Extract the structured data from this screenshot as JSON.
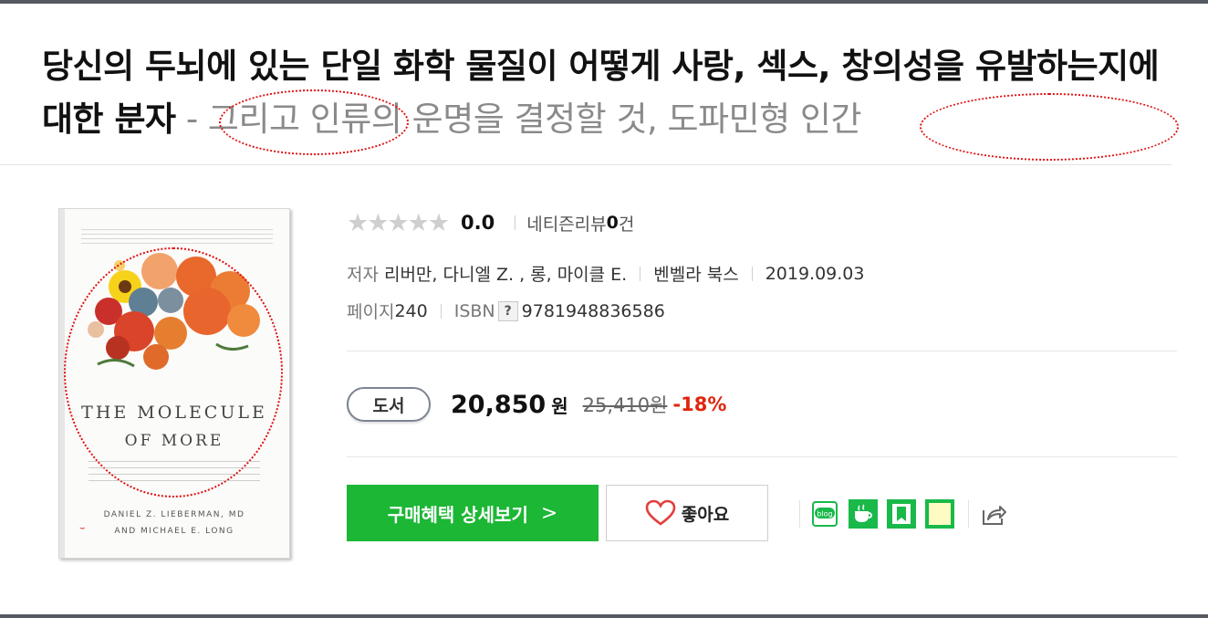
{
  "title": {
    "main": "당신의 두뇌에 있는 단일 화학 물질이 어떻게 사랑, 섹스, 창의성을 유발하는지에 대한 분자",
    "sub": "- 그리고 인류의 운명을 결정할 것, 도파민형 인간"
  },
  "cover": {
    "title_line1": "THE MOLECULE",
    "title_line2": "OF MORE",
    "author1": "DANIEL Z. LIEBERMAN, MD",
    "author2": "AND MICHAEL E. LONG"
  },
  "rating": {
    "stars": "★★★★★",
    "value": "0.0",
    "review_label": "네티즌리뷰",
    "review_count": "0",
    "review_unit": "건"
  },
  "meta": {
    "author_label": "저자",
    "authors": "리버만, 다니엘 Z. , 롱, 마이클 E.",
    "publisher": "벤벨라 북스",
    "date": "2019.09.03",
    "page_label": "페이지",
    "pages": "240",
    "isbn_label": "ISBN",
    "isbn_help": "?",
    "isbn": "9781948836586"
  },
  "price": {
    "badge": "도서",
    "sale_price": "20,850",
    "unit": "원",
    "original": "25,410원",
    "discount": "-18%"
  },
  "actions": {
    "buy_label": "구매혜택 상세보기",
    "buy_chevron": ">",
    "like_label": "좋아요"
  },
  "share": {
    "icons": [
      "blog-icon",
      "cafe-icon",
      "bookmark-icon",
      "memo-icon",
      "share-icon"
    ],
    "blog_text": "blog"
  },
  "colors": {
    "accent_green": "#1cb735",
    "discount_red": "#e0260d",
    "annotation_red": "#e01010"
  }
}
